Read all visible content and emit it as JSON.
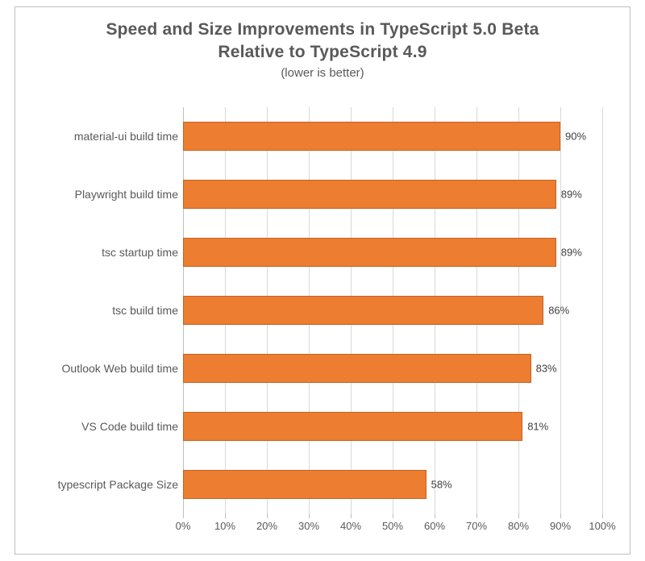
{
  "chart_data": {
    "type": "bar",
    "orientation": "horizontal",
    "title_line1": "Speed and Size Improvements in TypeScript 5.0 Beta",
    "title_line2": "Relative to TypeScript 4.9",
    "subtitle": "(lower is better)",
    "categories": [
      "material-ui build time",
      "Playwright build time",
      "tsc startup time",
      "tsc build time",
      "Outlook Web build time",
      "VS Code build time",
      "typescript Package Size"
    ],
    "values": [
      90,
      89,
      89,
      86,
      83,
      81,
      58
    ],
    "value_labels": [
      "90%",
      "89%",
      "89%",
      "86%",
      "83%",
      "81%",
      "58%"
    ],
    "xaxis_ticks": [
      0,
      10,
      20,
      30,
      40,
      50,
      60,
      70,
      80,
      90,
      100
    ],
    "xaxis_tick_labels": [
      "0%",
      "10%",
      "20%",
      "30%",
      "40%",
      "50%",
      "60%",
      "70%",
      "80%",
      "90%",
      "100%"
    ],
    "xlim": [
      0,
      100
    ],
    "ylabel": "",
    "xlabel": "",
    "bar_color": "#ed7d31",
    "bar_border": "#c46424",
    "grid": true
  }
}
